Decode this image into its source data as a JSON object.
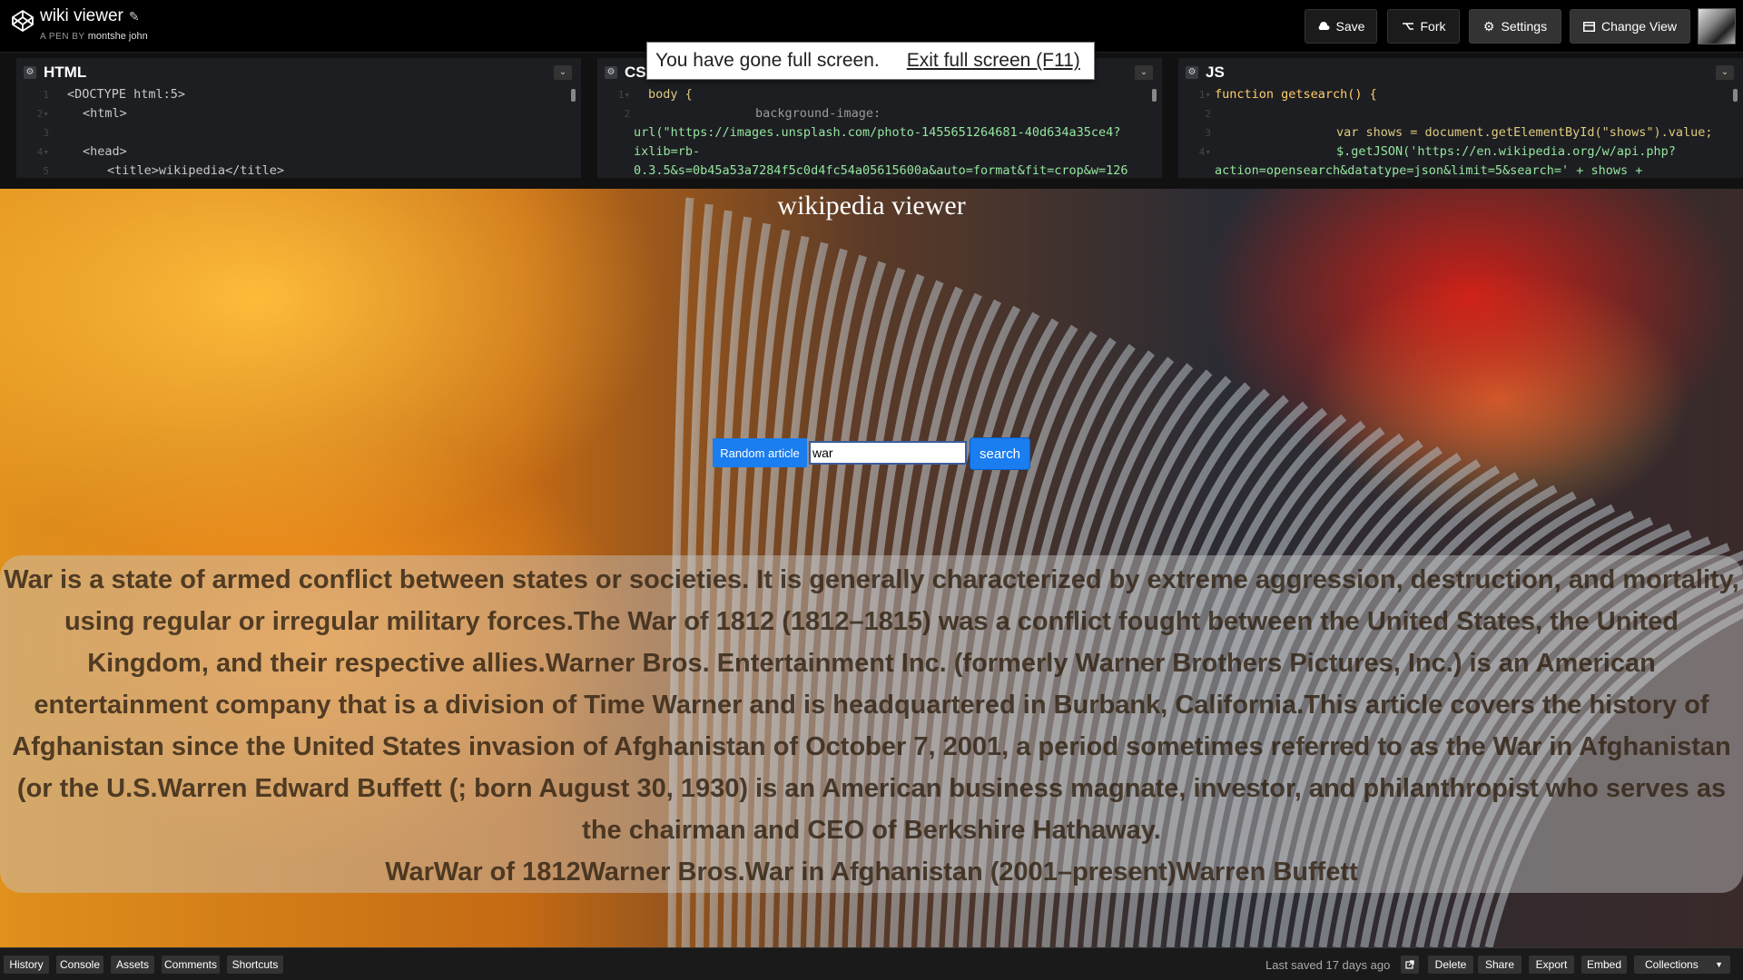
{
  "header": {
    "title": "wiki viewer",
    "author_prefix": "A PEN BY",
    "author": "montshe john",
    "buttons": {
      "save": "Save",
      "fork": "Fork",
      "settings": "Settings",
      "change_view": "Change View"
    }
  },
  "editors": {
    "html": {
      "label": "HTML",
      "lines": [
        "<DOCTYPE html:5>",
        "<html>",
        "",
        "<head>",
        "<title>wikipedia</title>"
      ]
    },
    "css": {
      "label": "CSS",
      "lines": [
        "body {",
        "background-image:",
        "url(\"https://images.unsplash.com/photo-1455651264681-40d634a35ce4?",
        "ixlib=rb-",
        "0.3.5&s=0b45a53a7284f5c0d4fc54a05615600a&auto=format&fit=crop&w=126"
      ]
    },
    "js": {
      "label": "JS",
      "lines": [
        "function getsearch() {",
        "",
        "var shows = document.getElementById(\"shows\").value;",
        "$.getJSON('https://en.wikipedia.org/w/api.php?",
        "action=opensearch&datatype=json&limit=5&search=' + shows +"
      ]
    }
  },
  "fullscreen_notice": {
    "message": "You have gone full screen.",
    "exit": "Exit full screen (F11)"
  },
  "preview": {
    "title": "wikipedia viewer",
    "random_button": "Random article",
    "search_value": "war",
    "search_button": "search",
    "results_text": "War is a state of armed conflict between states or societies. It is generally characterized by extreme aggression, destruction, and mortality, using regular or irregular military forces.The War of 1812 (1812–1815) was a conflict fought between the United States, the United Kingdom, and their respective allies.Warner Bros. Entertainment Inc. (formerly Warner Brothers Pictures, Inc.) is an American entertainment company that is a division of Time Warner and is headquartered in Burbank, California.This article covers the history of Afghanistan since the United States invasion of Afghanistan of October 7, 2001, a period sometimes referred to as the War in Afghanistan (or the U.S.Warren Edward Buffett (; born August 30, 1930) is an American business magnate, investor, and philanthropist who serves as the chairman and CEO of Berkshire Hathaway.",
    "results_titles": "WarWar of 1812Warner Bros.War in Afghanistan (2001–present)Warren Buffett"
  },
  "bottom_bar": {
    "history": "History",
    "console": "Console",
    "assets": "Assets",
    "comments": "Comments",
    "shortcuts": "Shortcuts",
    "last_saved": "Last saved 17 days ago",
    "delete": "Delete",
    "share": "Share",
    "export": "Export",
    "embed": "Embed",
    "collections": "Collections"
  },
  "colors": {
    "accent_blue": "#1a7df0",
    "header_bg": "#000000",
    "editor_bg": "#1d1e22"
  }
}
